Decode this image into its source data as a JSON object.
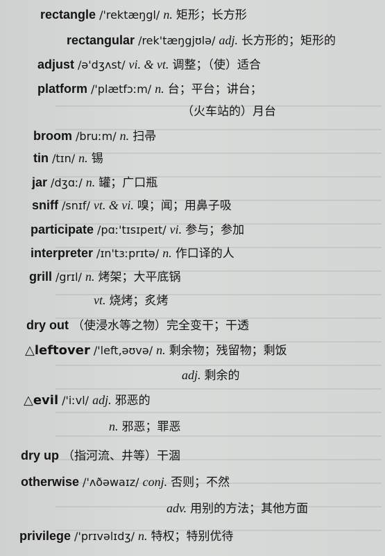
{
  "entries": [
    {
      "hw": "rectangle",
      "bold": false,
      "pron": "/'rektæŋgl/",
      "pos": "n.",
      "def": "矩形；长方形"
    },
    {
      "hw": "rectangular",
      "bold": false,
      "pron": "/rek'tæŋgjʊlə/",
      "pos": "adj.",
      "def": "长方形的；矩形的"
    },
    {
      "hw": "adjust",
      "bold": true,
      "pron": "/ə'dʒʌst/",
      "pos": "vi. & vt.",
      "def": "调整；（使）适合"
    },
    {
      "hw": "platform",
      "bold": false,
      "pron": "/'plætfɔːm/",
      "pos": "n.",
      "def": "台；平台；讲台；"
    },
    {
      "hw": "",
      "bold": false,
      "pron": "",
      "pos": "",
      "def": "（火车站的）月台"
    },
    {
      "hw": "broom",
      "bold": false,
      "pron": "/bruːm/",
      "pos": "n.",
      "def": "扫帚"
    },
    {
      "hw": "tin",
      "bold": false,
      "pron": "/tɪn/",
      "pos": "n.",
      "def": "锡"
    },
    {
      "hw": "jar",
      "bold": false,
      "pron": "/dʒɑː/",
      "pos": "n.",
      "def": "罐；广口瓶"
    },
    {
      "hw": "sniff",
      "bold": false,
      "pron": "/snɪf/",
      "pos": "vt. & vi.",
      "def": "嗅；闻；用鼻子吸"
    },
    {
      "hw": "participate",
      "bold": true,
      "pron": "/pɑː'tɪsɪpeɪt/",
      "pos": "vi.",
      "def": "参与；参加"
    },
    {
      "hw": "interpreter",
      "bold": false,
      "pron": "/ɪn'tɜːprɪtə/",
      "pos": "n.",
      "def": "作口译的人"
    },
    {
      "hw": "grill",
      "bold": false,
      "pron": "/grɪl/",
      "pos": "n.",
      "def": "烤架；大平底锅"
    },
    {
      "hw": "",
      "bold": false,
      "pron": "",
      "pos": "vt.",
      "def": "烧烤；炙烤"
    },
    {
      "hw": "dry out",
      "bold": true,
      "pron": "",
      "pos": "",
      "def": "（使浸水等之物）完全变干；干透"
    },
    {
      "hw": "△leftover",
      "bold": false,
      "pron": "/'left,əʊvə/",
      "pos": "n.",
      "def": "剩余物；残留物；剩饭"
    },
    {
      "hw": "",
      "bold": false,
      "pron": "",
      "pos": "adj.",
      "def": "剩余的"
    },
    {
      "hw": "△evil",
      "bold": false,
      "pron": "/'iːvl/",
      "pos": "adj.",
      "def": "邪恶的"
    },
    {
      "hw": "",
      "bold": false,
      "pron": "",
      "pos": "n.",
      "def": "邪恶；罪恶"
    },
    {
      "hw": "dry up",
      "bold": true,
      "pron": "",
      "pos": "",
      "def": "（指河流、井等）干涸"
    },
    {
      "hw": "otherwise",
      "bold": true,
      "pron": "/'ʌðəwaɪz/",
      "pos": "conj.",
      "def": "否则；不然"
    },
    {
      "hw": "",
      "bold": false,
      "pron": "",
      "pos": "adv.",
      "def": "用别的方法；其他方面"
    },
    {
      "hw": "privilege",
      "bold": false,
      "pron": "/'prɪvəlɪdʒ/",
      "pos": "n.",
      "def": "特权；特别优待"
    }
  ]
}
